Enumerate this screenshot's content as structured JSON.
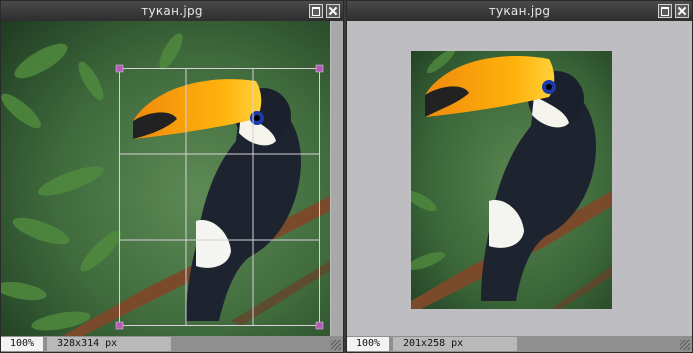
{
  "left_window": {
    "title": "тукан.jpg",
    "zoom": "100%",
    "dimensions": "328x314 px"
  },
  "right_window": {
    "title": "тукан.jpg",
    "zoom": "100%",
    "dimensions": "201x258 px"
  },
  "icons": {
    "maximize": "maximize-icon",
    "close": "close-icon",
    "resize": "resize-grip-icon"
  },
  "colors": {
    "title_bar": "#3a3a3a",
    "crop_handle": "#b25fb3",
    "crop_grid": "#d9d0d9"
  }
}
